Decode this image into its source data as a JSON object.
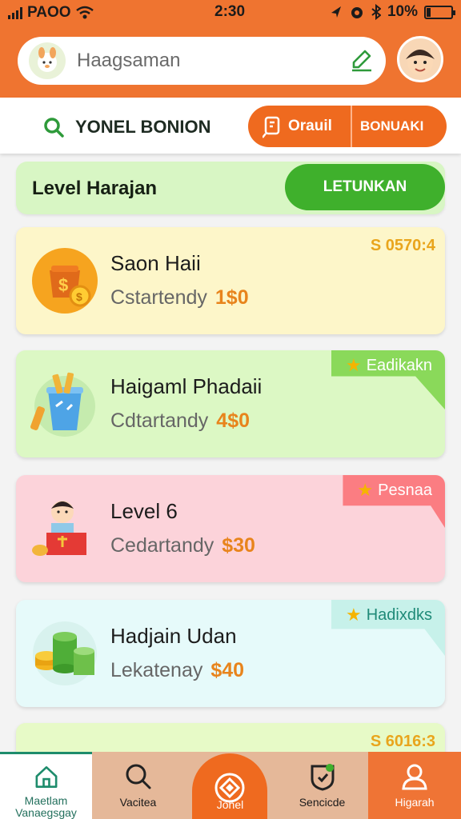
{
  "status_bar": {
    "carrier": "PAOO",
    "time": "2:30",
    "battery": "10%"
  },
  "header": {
    "search_placeholder": "Haagsaman",
    "icons": [
      "app-logo-icon",
      "edit-icon",
      "avatar"
    ]
  },
  "subheader": {
    "title": "YONEL BONION",
    "tab_primary": "Orauil",
    "tab_secondary": "BONUAKI"
  },
  "level_banner": {
    "title": "Level Harajan",
    "button_label": "LETUNKAN"
  },
  "cards": [
    {
      "name": "Saon Haii",
      "subtitle": "Cstartendy",
      "amount": "1$0",
      "price": "S 0570:4",
      "ribbon": ""
    },
    {
      "name": "Haigaml Phadaii",
      "subtitle": "Cdtartandy",
      "amount": "4$0",
      "price": "",
      "ribbon": "Eadikakn"
    },
    {
      "name": "Level 6",
      "subtitle": "Cedartandy",
      "amount": "$30",
      "price": "",
      "ribbon": "Pesnaa"
    },
    {
      "name": "Hadjain Udan",
      "subtitle": "Lekatenay",
      "amount": "$40",
      "price": "",
      "ribbon": "Hadixdks"
    },
    {
      "name": "",
      "subtitle": "",
      "amount": "",
      "price": "S 6016:3",
      "ribbon": ""
    }
  ],
  "bottom_nav": [
    {
      "label": "Maetlam\nVanaegsgay",
      "icon": "home-icon"
    },
    {
      "label": "Vacitea",
      "icon": "search-icon"
    },
    {
      "label": "Jonel",
      "icon": "diamond-icon"
    },
    {
      "label": "Sencicde",
      "icon": "shield-icon"
    },
    {
      "label": "Higarah",
      "icon": "user-icon"
    }
  ],
  "colors": {
    "brand": "#ef7430",
    "accent_green": "#3fb02c",
    "amount": "#e8841c"
  }
}
